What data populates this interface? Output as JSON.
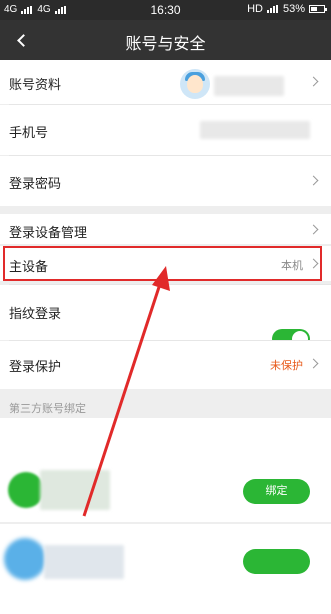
{
  "status_bar": {
    "network_left": [
      "4G",
      "4G"
    ],
    "time": "16:30",
    "network_right": "HD",
    "battery": "53%",
    "battery_level": 0.53
  },
  "header": {
    "title": "账号与安全"
  },
  "rows": {
    "account_profile": "账号资料",
    "phone": "手机号",
    "login_password": "登录密码",
    "login_devices": "登录设备管理",
    "main_device": "主设备",
    "main_device_value": "本机",
    "fingerprint_login": "指纹登录",
    "fingerprint_enabled": true,
    "login_protection": "登录保护",
    "login_protection_value": "未保护",
    "login_protection_color": "#e85a1a"
  },
  "third_party": {
    "title": "第三方账号绑定",
    "bind_label": "绑定"
  },
  "colors": {
    "accent_green": "#2bb635",
    "highlight_red": "#e12a2a"
  }
}
